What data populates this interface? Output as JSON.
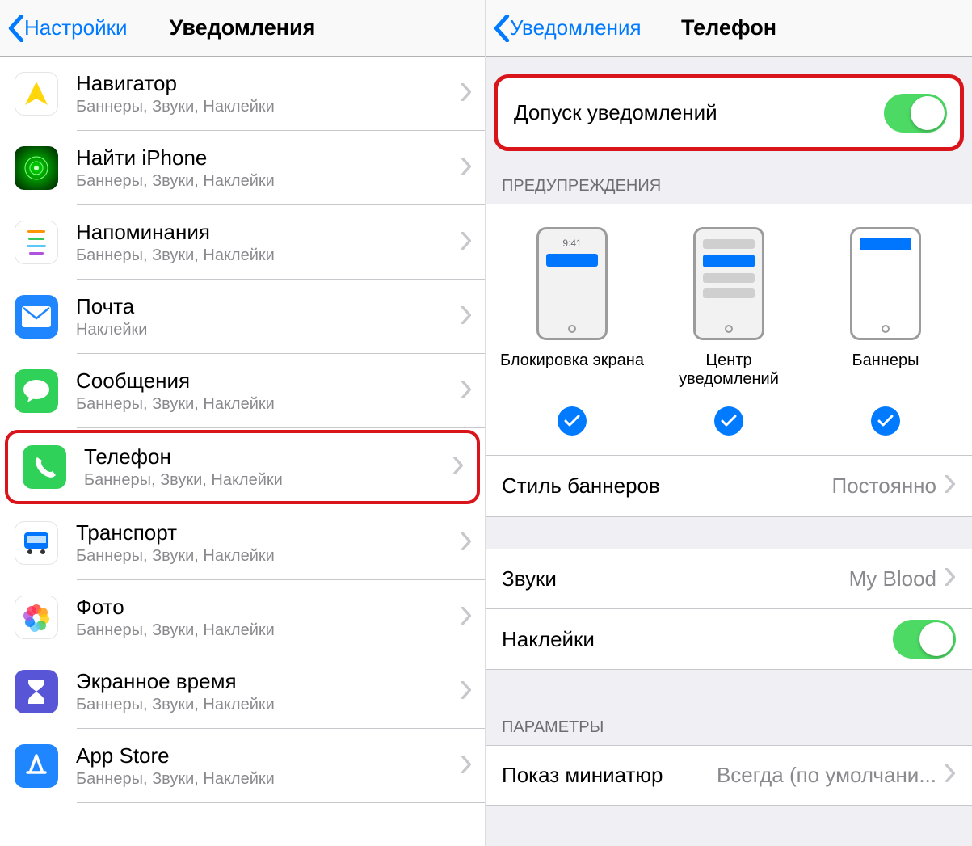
{
  "left": {
    "back_label": "Настройки",
    "title": "Уведомления",
    "items": [
      {
        "name": "Навигатор",
        "sub": "Баннеры, Звуки, Наклейки"
      },
      {
        "name": "Найти iPhone",
        "sub": "Баннеры, Звуки, Наклейки"
      },
      {
        "name": "Напоминания",
        "sub": "Баннеры, Звуки, Наклейки"
      },
      {
        "name": "Почта",
        "sub": "Наклейки"
      },
      {
        "name": "Сообщения",
        "sub": "Баннеры, Звуки, Наклейки"
      },
      {
        "name": "Телефон",
        "sub": "Баннеры, Звуки, Наклейки"
      },
      {
        "name": "Транспорт",
        "sub": "Баннеры, Звуки, Наклейки"
      },
      {
        "name": "Фото",
        "sub": "Баннеры, Звуки, Наклейки"
      },
      {
        "name": "Экранное время",
        "sub": "Баннеры, Звуки, Наклейки"
      },
      {
        "name": "App Store",
        "sub": "Баннеры, Звуки, Наклейки"
      }
    ]
  },
  "right": {
    "back_label": "Уведомления",
    "title": "Телефон",
    "allow_label": "Допуск уведомлений",
    "allow_on": true,
    "alerts_header": "ПРЕДУПРЕЖДЕНИЯ",
    "alerts": [
      {
        "label": "Блокировка экрана",
        "time": "9:41"
      },
      {
        "label": "Центр уведомлений"
      },
      {
        "label": "Баннеры"
      }
    ],
    "banner_style_label": "Стиль баннеров",
    "banner_style_value": "Постоянно",
    "sounds_label": "Звуки",
    "sounds_value": "My Blood",
    "badges_label": "Наклейки",
    "badges_on": true,
    "options_header": "ПАРАМЕТРЫ",
    "mini_preview_label": "Показ миниатюр",
    "mini_preview_value": "Всегда (по умолчани..."
  },
  "colors": {
    "highlight": "#d9141a",
    "toggle_on": "#4cd964",
    "link": "#007aff"
  }
}
